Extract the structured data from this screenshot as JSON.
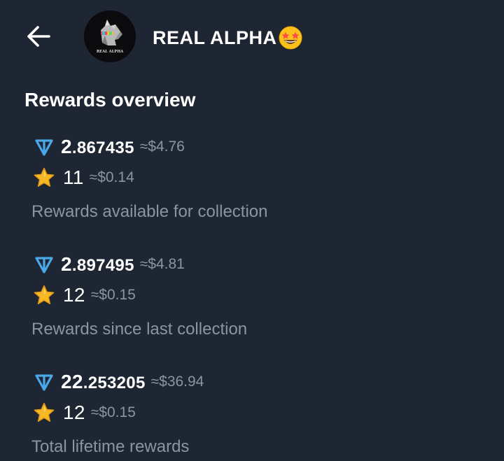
{
  "header": {
    "back_icon": "arrow-left-icon",
    "avatar_text": "REAL ALPHA",
    "title": "REAL ALPHA",
    "title_emoji": "star-struck-emoji"
  },
  "section": {
    "title": "Rewards overview"
  },
  "colors": {
    "background": "#1e2633",
    "text_primary": "#ffffff",
    "text_secondary": "#8a95a3",
    "ton_icon": "#4aa8e8",
    "star_icon": "#f7b928"
  },
  "rewards": [
    {
      "ton_int": "2",
      "ton_frac": ".867435",
      "ton_usd": "≈$4.76",
      "stars": "11",
      "stars_usd": "≈$0.14",
      "caption": "Rewards available for collection"
    },
    {
      "ton_int": "2",
      "ton_frac": ".897495",
      "ton_usd": "≈$4.81",
      "stars": "12",
      "stars_usd": "≈$0.15",
      "caption": "Rewards since last collection"
    },
    {
      "ton_int": "22",
      "ton_frac": ".253205",
      "ton_usd": "≈$36.94",
      "stars": "12",
      "stars_usd": "≈$0.15",
      "caption": "Total lifetime rewards"
    }
  ]
}
